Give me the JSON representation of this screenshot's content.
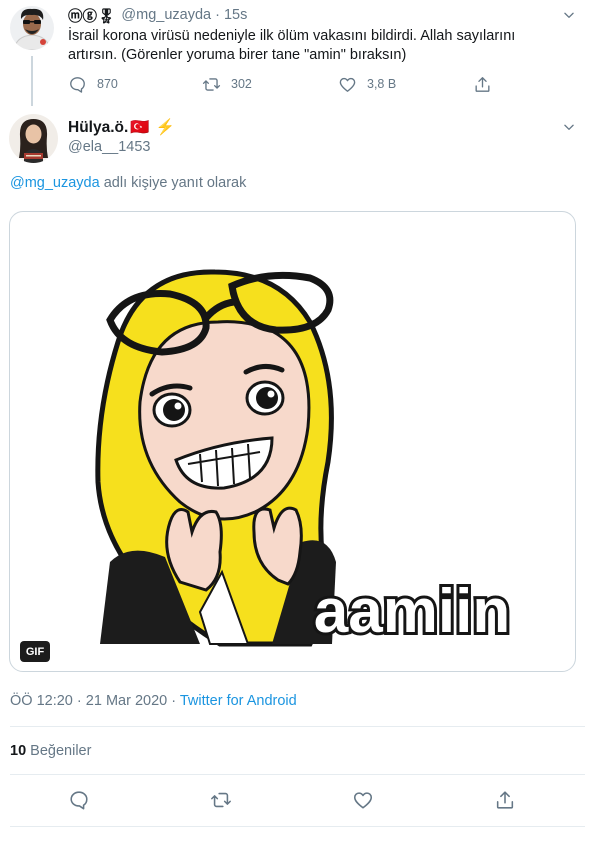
{
  "parent_tweet": {
    "display_name": "ⓜⓖ🎖",
    "handle": "@mg_uzayda",
    "separator": "·",
    "time": "15s",
    "text": "İsrail korona virüsü nedeniyle ilk ölüm vakasını bildirdi. Allah sayılarını artırsın. (Görenler yoruma birer tane \"amin\" bıraksın)",
    "replies": "870",
    "retweets": "302",
    "likes": "3,8 B"
  },
  "reply_tweet": {
    "display_name": "Hülya.ö.",
    "flag": "🇹🇷",
    "bolt": "⚡",
    "handle": "@ela__1453",
    "reply_prefix": "@mg_uzayda",
    "reply_suffix": " adlı kişiye yanıt olarak",
    "media": {
      "badge": "GIF",
      "caption": "aamiin"
    },
    "time": "ÖÖ 12:20",
    "date": "21 Mar 2020",
    "separator": "·",
    "source": "Twitter for Android",
    "like_count": "10",
    "like_label": "Beğeniler"
  },
  "colors": {
    "accent": "#1b95e0",
    "muted": "#657786",
    "border": "#ccd6dd",
    "hijab_yellow": "#f6e01d"
  },
  "icons": [
    "chevron-down-icon",
    "reply-icon",
    "retweet-icon",
    "like-icon",
    "share-icon"
  ]
}
